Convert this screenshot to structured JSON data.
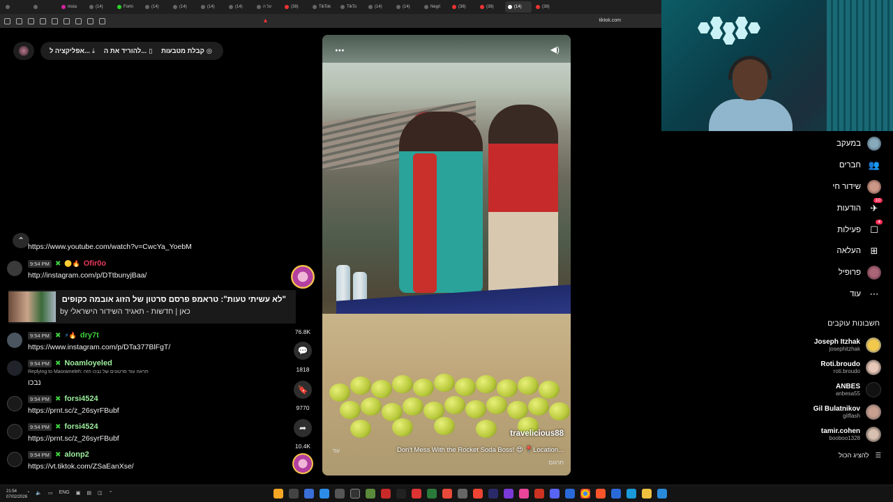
{
  "browser": {
    "tabs": [
      "",
      "",
      "Insta",
      "(14)",
      "Fortn",
      "(14)",
      "(14)",
      "(14)",
      "(14)",
      "על ה",
      "(38)",
      "TikTok",
      "TikTo",
      "(14)",
      "(14)",
      "Negri",
      "(38)",
      "(38)",
      "(14)",
      "(38)",
      ""
    ],
    "url": "tiktok.com"
  },
  "overlay": {
    "get_coins": "קבלת מטבעות",
    "download": "להוריד את ה...",
    "app": "אפליקציה ל..."
  },
  "chat": {
    "first_link": "https://www.youtube.com/watch?v=CwcYa_YoebM",
    "messages": [
      {
        "time": "9:54 PM",
        "user": "Ofir0o",
        "text": "http://instagram.com/p/DTtbunyjBaa/"
      },
      {
        "time": "9:54 PM",
        "user": "dry7t",
        "text": "https://www.instagram.com/p/DTa377BlFgT/"
      },
      {
        "time": "9:54 PM",
        "user": "Noamloyeled",
        "reply": "Replying to Maorameleh: תראה עוד סרטונים של נבכו הזה",
        "text": "נבכו"
      },
      {
        "time": "9:54 PM",
        "user": "forsi4524",
        "text": "https://prnt.sc/z_26syrFBubf"
      },
      {
        "time": "9:54 PM",
        "user": "forsi4524",
        "text": "https://prnt.sc/z_26syrFBubf"
      },
      {
        "time": "9:54 PM",
        "user": "alonp2",
        "text": "https://vt.tiktok.com/ZSaEanXse/"
      }
    ],
    "youtube_card": {
      "title": "\"לא עשיתי טעות\": טראמפ פרסם סרטון של הזוג אובמה כקופים",
      "channel": "by כאן | חדשות - תאגיד השידור הישראלי"
    }
  },
  "video": {
    "author": "travelicious88",
    "description": "Don't Mess With the Rocket Soda Boss! 😍 📍Location...",
    "more": "עוד",
    "translate": "תרגום",
    "stats": {
      "likes": "76.8K",
      "comments": "1818",
      "saves": "9770",
      "shares": "10.4K"
    }
  },
  "sidebar": {
    "nav": [
      {
        "label": "במעקב",
        "icon": "avatar-icon"
      },
      {
        "label": "חברים",
        "icon": "friends-icon"
      },
      {
        "label": "שידור חי",
        "icon": "live-icon"
      },
      {
        "label": "הודעות",
        "icon": "messages-icon",
        "badge": "10"
      },
      {
        "label": "פעילות",
        "icon": "activity-icon",
        "badge": "4"
      },
      {
        "label": "העלאה",
        "icon": "upload-icon"
      },
      {
        "label": "פרופיל",
        "icon": "profile-icon"
      },
      {
        "label": "עוד",
        "icon": "more-icon"
      }
    ],
    "following_title": "חשבונות עוקבים",
    "accounts": [
      {
        "name": "Joseph Itzhak",
        "handle": "josephitzhak"
      },
      {
        "name": "Roti.broudo",
        "handle": "roti.broudo"
      },
      {
        "name": "ANBES",
        "handle": "anbesa55"
      },
      {
        "name": "Gil Bulatnikov",
        "handle": "gilflash"
      },
      {
        "name": "tamir.cohen",
        "handle": "booboo1328"
      }
    ],
    "show_all": "להציג הכול"
  },
  "taskbar": {
    "time": "21:54",
    "date": "07/02/2026",
    "lang": "ENG"
  },
  "colors": {
    "accent": "#fe2c55",
    "mod_badge": "#3ecf3e"
  }
}
